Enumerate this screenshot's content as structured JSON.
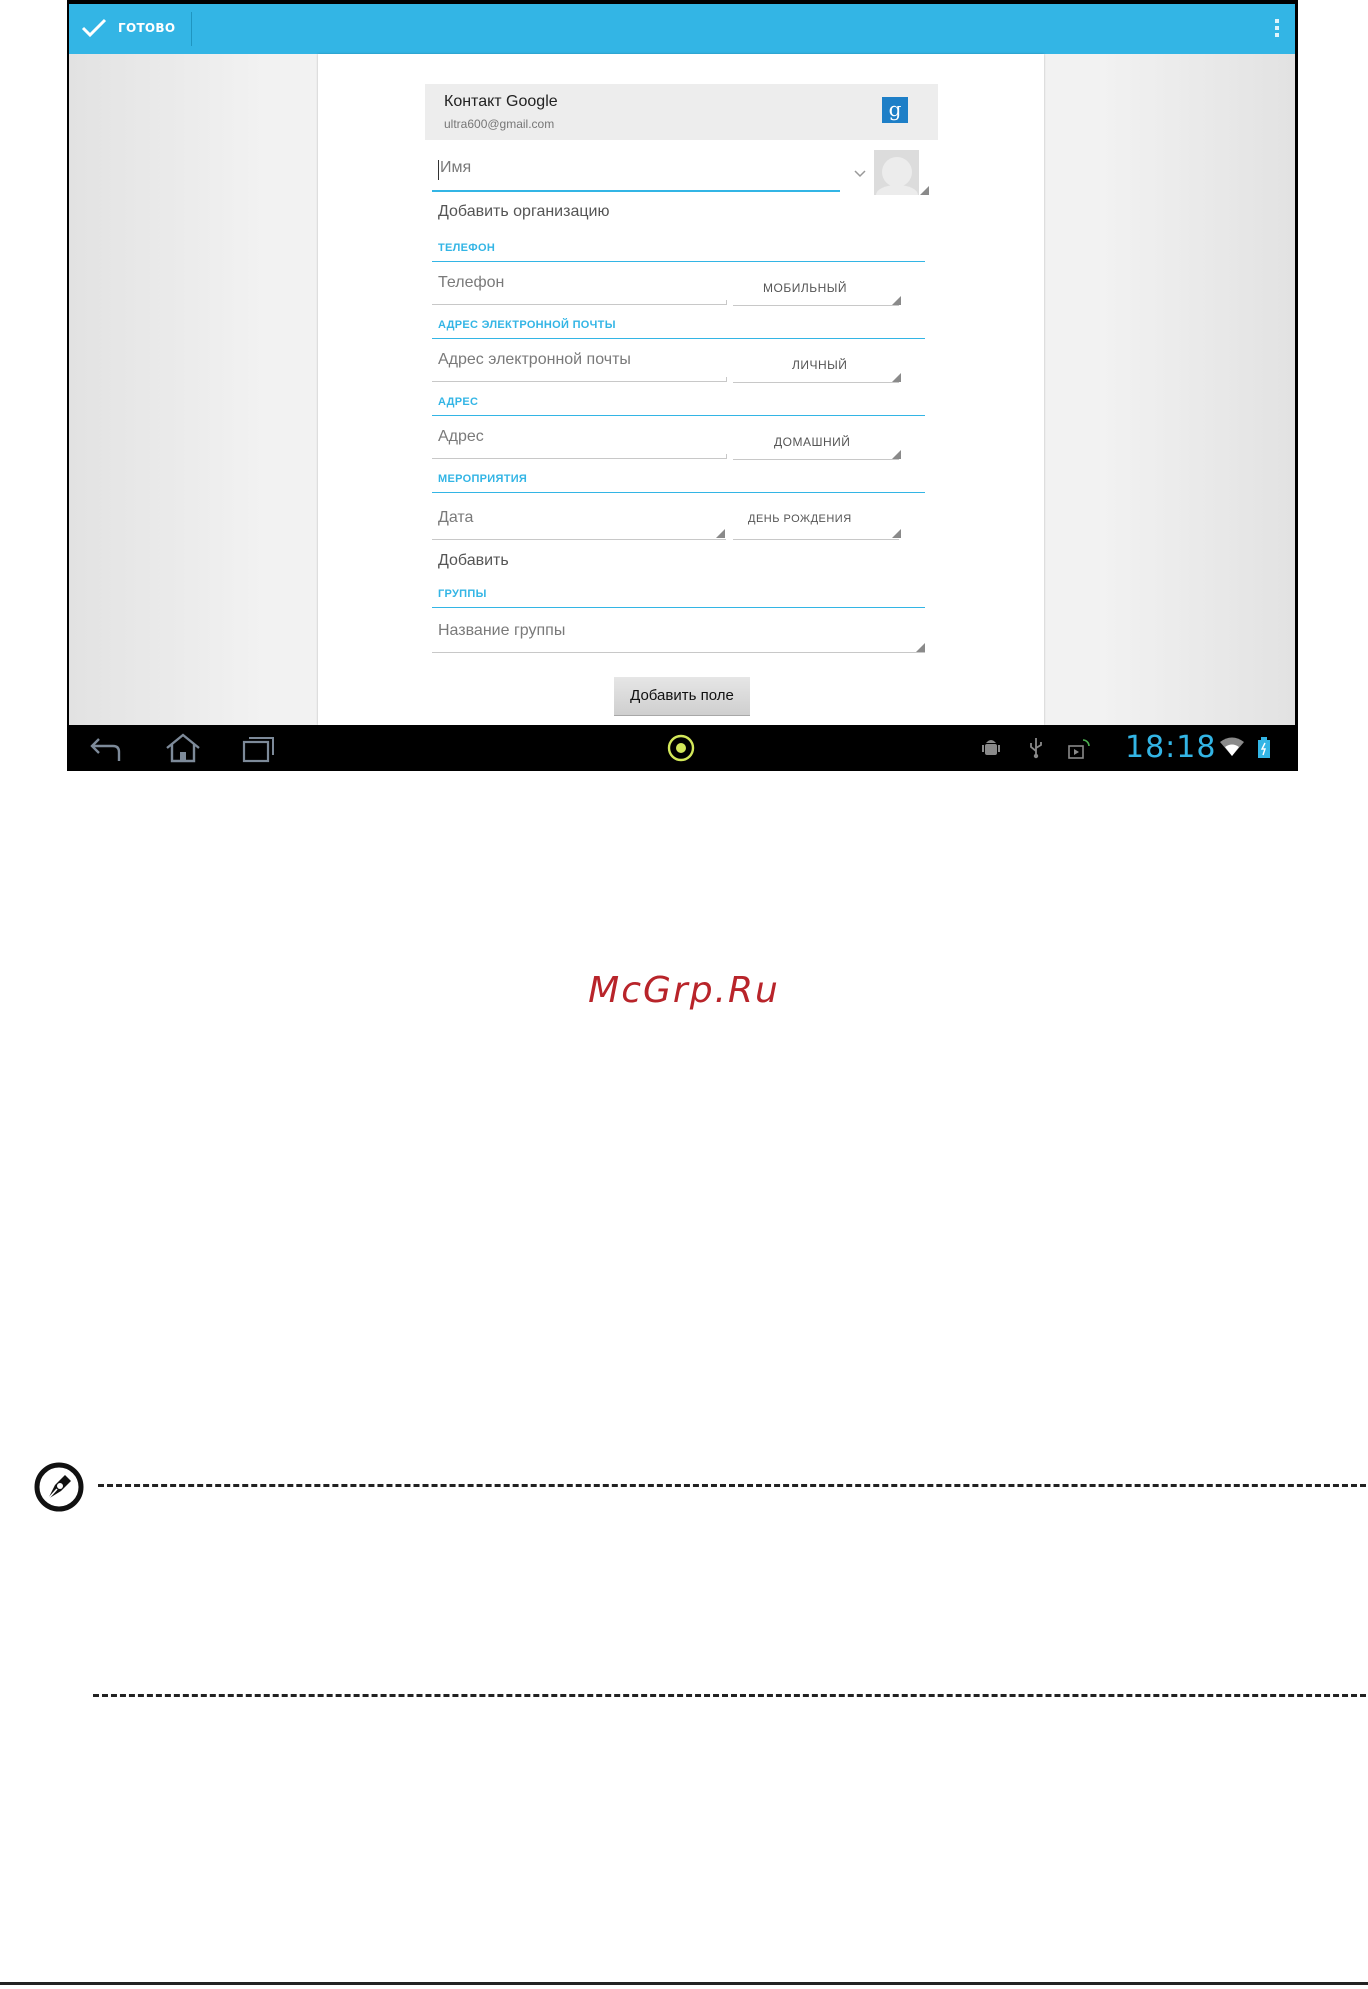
{
  "action_bar": {
    "done_label": "ГОТОВО",
    "overflow_icon": "overflow-menu-icon",
    "accent": "#33b5e5"
  },
  "account": {
    "name": "Контакт Google",
    "email": "ultra600@gmail.com",
    "icon": "google-g-icon",
    "icon_letter": "g"
  },
  "name_field": {
    "placeholder": "Имя"
  },
  "add_organization": "Добавить организацию",
  "sections": {
    "phone": {
      "header": "Телефон",
      "placeholder": "Телефон",
      "type": "Мобильный"
    },
    "email": {
      "header": "Адрес электронной почты",
      "placeholder": "Адрес электронной почты",
      "type": "Личный"
    },
    "address": {
      "header": "Адрес",
      "placeholder": "Адрес",
      "type": "Домашний"
    },
    "events": {
      "header": "Мероприятия",
      "date_placeholder": "Дата",
      "type": "День рождения",
      "add_label": "Добавить"
    },
    "groups": {
      "header": "Группы",
      "placeholder": "Название группы"
    }
  },
  "add_field_button": "Добавить поле",
  "status_bar": {
    "time": "18:18",
    "icons": [
      "android-debug-icon",
      "usb-icon",
      "media-play-icon",
      "wifi-icon",
      "battery-icon"
    ]
  },
  "nav_bar": {
    "icons": [
      "back-icon",
      "home-icon",
      "recent-apps-icon",
      "center-dot-icon"
    ]
  },
  "watermark": "McGrp.Ru"
}
